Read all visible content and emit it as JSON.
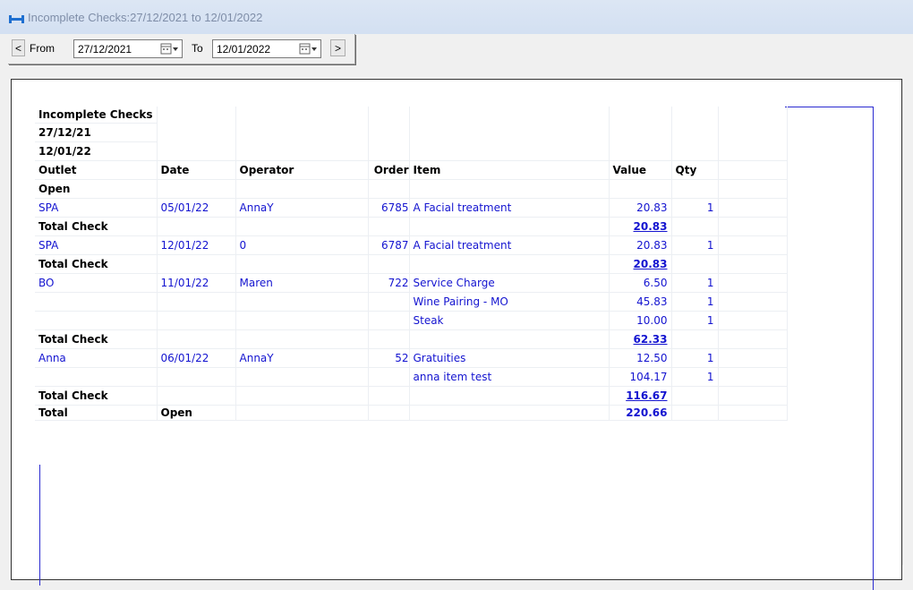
{
  "window": {
    "title": "Incomplete Checks:27/12/2021 to 12/01/2022"
  },
  "toolbar": {
    "prev_label": "<",
    "from_label": "From",
    "from_value": "27/12/2021",
    "to_label": "To",
    "to_value": "12/01/2022",
    "next_label": ">"
  },
  "report": {
    "header": {
      "title": "Incomplete Checks",
      "date_from": "27/12/21",
      "date_to": "12/01/22"
    },
    "columns": {
      "outlet": "Outlet",
      "date": "Date",
      "operator": "Operator",
      "order": "Order",
      "item": "Item",
      "value": "Value",
      "qty": "Qty"
    },
    "group_label": "Open",
    "rows": [
      {
        "outlet": "SPA",
        "date": "05/01/22",
        "operator": "AnnaY",
        "order": "6785",
        "item": "A Facial treatment",
        "value": "20.83",
        "qty": "1"
      },
      {
        "total_label": "Total Check",
        "total": "20.83"
      },
      {
        "outlet": "SPA",
        "date": "12/01/22",
        "operator": "0",
        "order": "6787",
        "item": "A Facial treatment",
        "value": "20.83",
        "qty": "1"
      },
      {
        "total_label": "Total Check",
        "total": "20.83"
      },
      {
        "outlet": "BO",
        "date": "11/01/22",
        "operator": "Maren",
        "order": "722",
        "item": "Service Charge",
        "value": "6.50",
        "qty": "1"
      },
      {
        "item": "Wine Pairing - MO",
        "value": "45.83",
        "qty": "1"
      },
      {
        "item": "Steak",
        "value": "10.00",
        "qty": "1"
      },
      {
        "total_label": "Total Check",
        "total": "62.33"
      },
      {
        "outlet": "Anna",
        "date": "06/01/22",
        "operator": "AnnaY",
        "order": "52",
        "item": "Gratuities",
        "value": "12.50",
        "qty": "1"
      },
      {
        "item": "anna item test",
        "value": "104.17",
        "qty": "1"
      },
      {
        "total_label": "Total Check",
        "total": "116.67"
      }
    ],
    "grand_total": {
      "label": "Total",
      "group": "Open",
      "value": "220.66"
    }
  }
}
